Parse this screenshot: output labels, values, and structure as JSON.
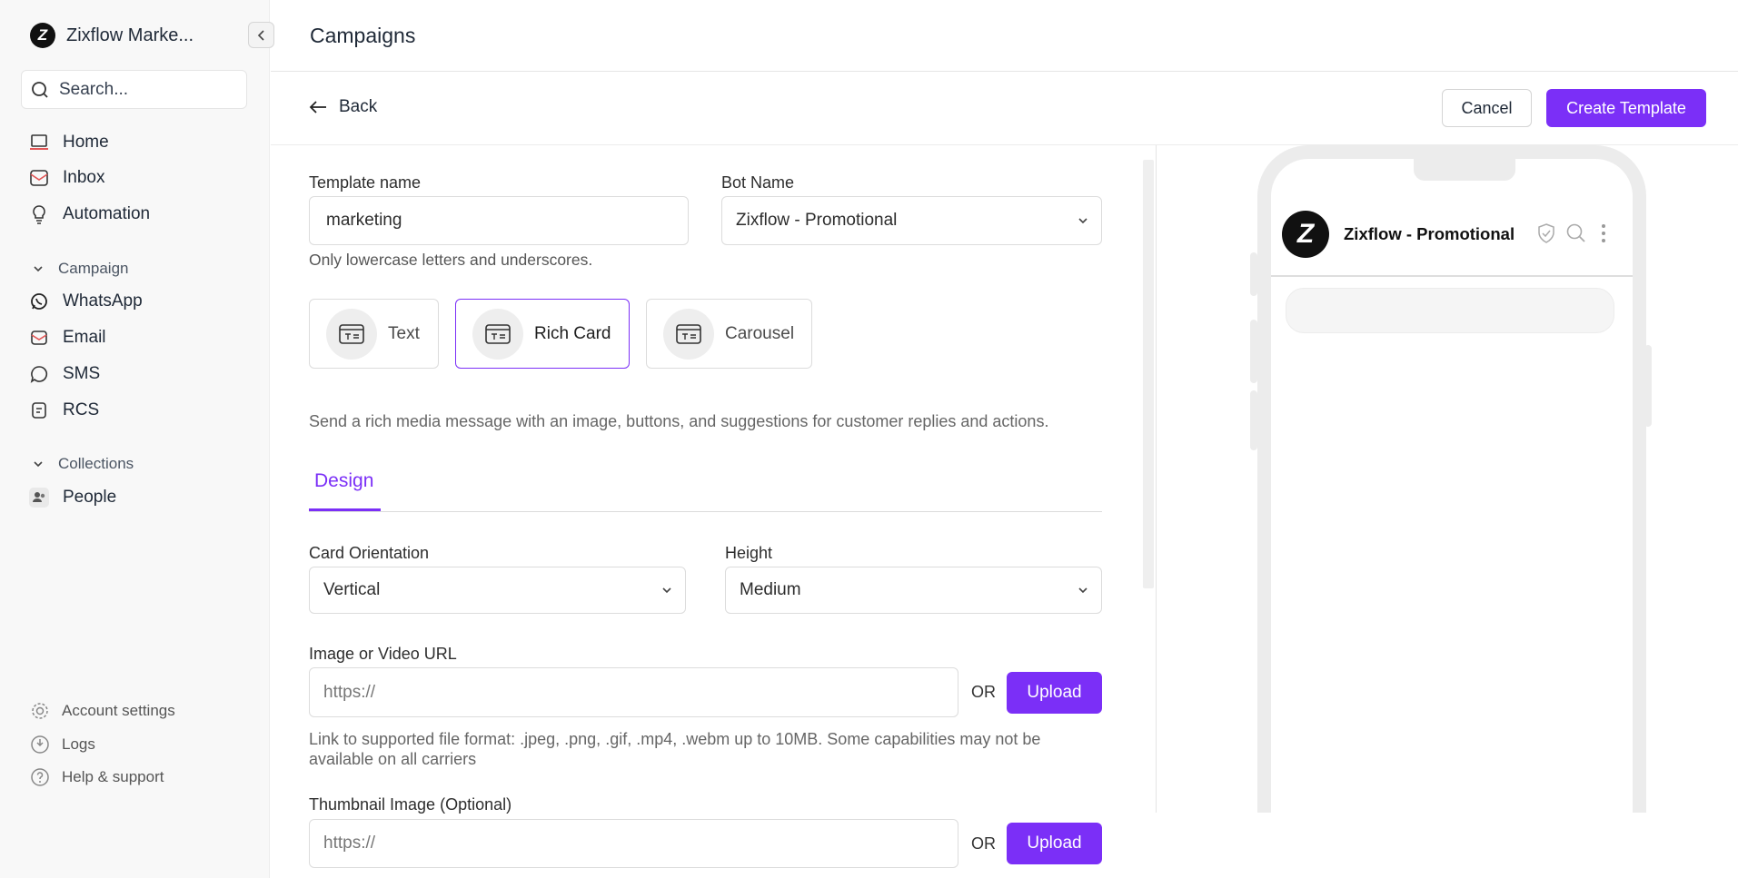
{
  "sidebar": {
    "workspace_name": "Zixflow Marke...",
    "logo_letter": "Z",
    "search_placeholder": "Search...",
    "nav": [
      {
        "label": "Home",
        "icon": "laptop-icon"
      },
      {
        "label": "Inbox",
        "icon": "inbox-icon"
      },
      {
        "label": "Automation",
        "icon": "lightbulb-icon"
      }
    ],
    "campaign_section": {
      "label": "Campaign",
      "items": [
        {
          "label": "WhatsApp",
          "icon": "whatsapp-icon"
        },
        {
          "label": "Email",
          "icon": "email-icon"
        },
        {
          "label": "SMS",
          "icon": "sms-icon"
        },
        {
          "label": "RCS",
          "icon": "rcs-icon"
        }
      ]
    },
    "collections_section": {
      "label": "Collections",
      "items": [
        {
          "label": "People",
          "icon": "people-icon"
        }
      ]
    },
    "footer": [
      {
        "label": "Account settings",
        "icon": "gear-icon"
      },
      {
        "label": "Logs",
        "icon": "logs-icon"
      },
      {
        "label": "Help & support",
        "icon": "help-icon"
      }
    ]
  },
  "header": {
    "title": "Campaigns",
    "back_label": "Back",
    "cancel_label": "Cancel",
    "create_label": "Create Template"
  },
  "form": {
    "template_name_label": "Template name",
    "template_name_value": "marketing",
    "template_name_hint": "Only lowercase letters and underscores.",
    "bot_name_label": "Bot Name",
    "bot_name_value": "Zixflow - Promotional",
    "types": [
      {
        "label": "Text",
        "active": false
      },
      {
        "label": "Rich Card",
        "active": true
      },
      {
        "label": "Carousel",
        "active": false
      }
    ],
    "type_description": "Send a rich media message with an image, buttons, and suggestions for customer replies and actions.",
    "tab_design": "Design",
    "card_orientation_label": "Card Orientation",
    "card_orientation_value": "Vertical",
    "height_label": "Height",
    "height_value": "Medium",
    "media_url_label": "Image or Video URL",
    "media_url_placeholder": "https://",
    "or_label": "OR",
    "upload_label": "Upload",
    "media_hint": "Link to supported file format: .jpeg, .png, .gif, .mp4, .webm up to 10MB. Some capabilities may not be available on all carriers",
    "thumbnail_label": "Thumbnail Image (Optional)",
    "thumbnail_placeholder": "https://"
  },
  "preview": {
    "bot_name": "Zixflow - Promotional",
    "logo_letter": "Z"
  },
  "colors": {
    "accent": "#7b2ff7",
    "sidebar_bg": "#f8f8f8"
  }
}
